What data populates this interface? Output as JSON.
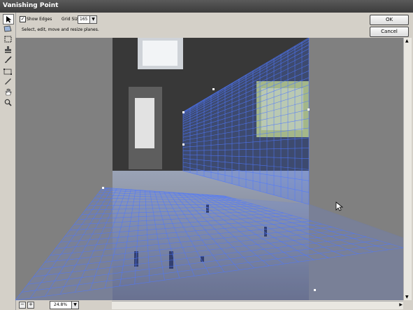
{
  "window": {
    "title": "Vanishing Point"
  },
  "options": {
    "show_edges_label": "Show Edges",
    "show_edges_checked": true,
    "grid_size_label": "Grid Size:",
    "grid_size_value": "165"
  },
  "status": {
    "hint": "Select, edit, move and resize planes."
  },
  "buttons": {
    "ok": "OK",
    "cancel": "Cancel"
  },
  "zoom": {
    "value": "24.8%",
    "minus": "−",
    "plus": "+"
  },
  "tools": [
    "edit-plane-tool",
    "create-plane-tool",
    "marquee-tool",
    "stamp-tool",
    "brush-tool",
    "transform-tool",
    "eyedropper-tool",
    "hand-tool",
    "zoom-tool"
  ],
  "colors": {
    "grid": "#4f78ff",
    "bg_gray": "#808080",
    "dialog": "#d4d0c8"
  }
}
